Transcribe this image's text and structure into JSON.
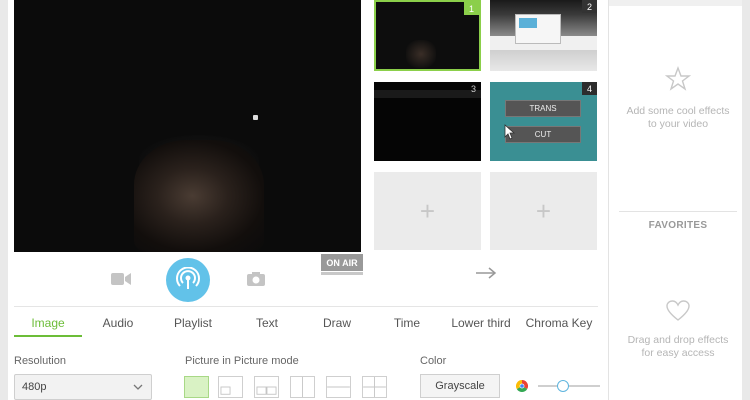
{
  "preview": {
    "onair_label": "ON AIR"
  },
  "scenes": [
    {
      "number": "1",
      "state": "active"
    },
    {
      "number": "2"
    },
    {
      "number": "3"
    },
    {
      "number": "4",
      "trans_label": "TRANS",
      "cut_label": "CUT"
    }
  ],
  "controls": {
    "icons": [
      "video-camera-icon",
      "broadcast-icon",
      "photo-camera-icon"
    ]
  },
  "tabs": [
    {
      "label": "Image",
      "active": true
    },
    {
      "label": "Audio"
    },
    {
      "label": "Playlist"
    },
    {
      "label": "Text"
    },
    {
      "label": "Draw"
    },
    {
      "label": "Time"
    },
    {
      "label": "Lower third"
    },
    {
      "label": "Chroma Key"
    }
  ],
  "image_settings": {
    "resolution_label": "Resolution",
    "resolution_value": "480p",
    "pip_label": "Picture in Picture mode",
    "color_label": "Color",
    "color_value": "Grayscale",
    "color_slider_level": 0.4
  },
  "effects_panel": {
    "empty_text": "Add some cool effects to your video",
    "favorites_title": "FAVORITES",
    "favorites_empty_text": "Drag and drop effects for easy access"
  },
  "colors": {
    "accent": "#6cbd38",
    "broadcast": "#62c2e9",
    "scene_active": "#8bcf4a"
  }
}
